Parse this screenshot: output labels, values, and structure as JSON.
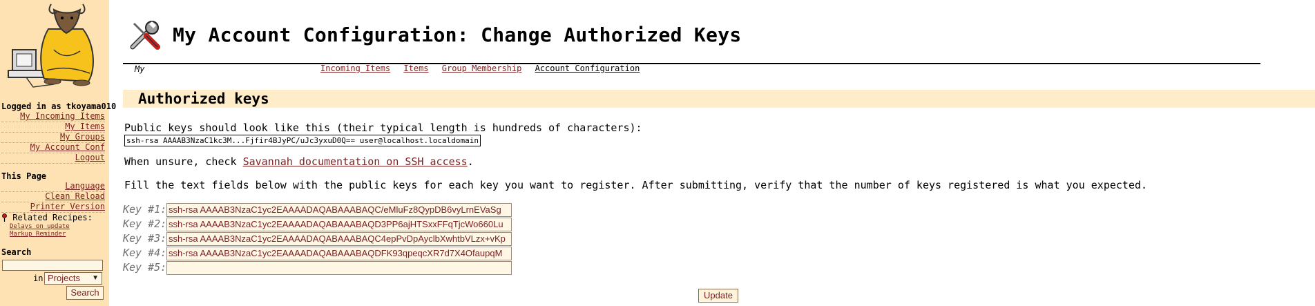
{
  "sidebar": {
    "logged_in": "Logged in as tkoyama010",
    "user_links": [
      "My Incoming Items",
      "My Items",
      "My Groups",
      "My Account Conf",
      "Logout"
    ],
    "this_page_heading": "This Page",
    "page_links": [
      "Language",
      "Clean Reload",
      "Printer Version"
    ],
    "related_heading": "Related Recipes:",
    "related_links": [
      "Delays on update",
      "Markup Reminder"
    ],
    "search": {
      "heading": "Search",
      "in_label": "in",
      "scope_value": "Projects",
      "button_label": "Search"
    }
  },
  "header": {
    "title": "My Account Configuration: Change Authorized Keys",
    "nav_my": "My",
    "nav_links": [
      {
        "label": "Incoming Items",
        "current": false
      },
      {
        "label": "Items",
        "current": false
      },
      {
        "label": "Group Membership",
        "current": false
      },
      {
        "label": "Account Configuration",
        "current": true
      }
    ]
  },
  "main": {
    "section_title": "Authorized keys",
    "intro": "Public keys should look like this (their typical length is hundreds of characters):",
    "example_key": "ssh-rsa AAAAB3NzaC1kc3M...Fjfir4BJyPC/uJc3yxuD0Q== user@localhost.localdomain",
    "unsure_prefix": "When unsure, check ",
    "unsure_link": "Savannah documentation on SSH access",
    "unsure_suffix": ".",
    "instructions": "Fill the text fields below with the public keys for each key you want to register. After submitting, verify that the number of keys registered is what you expected.",
    "keys": [
      {
        "label": "Key #1:",
        "value": "ssh-rsa AAAAB3NzaC1yc2EAAAADAQABAAABAQC/eMluFz8QypDB6vyLrnEVaSg"
      },
      {
        "label": "Key #2:",
        "value": "ssh-rsa AAAAB3NzaC1yc2EAAAADAQABAAABAQD3PP6ajHTSxxFFqTjcWo660Lu"
      },
      {
        "label": "Key #3:",
        "value": "ssh-rsa AAAAB3NzaC1yc2EAAAADAQABAAABAQC4epPvDpAyclbXwhtbVLzx+vKp"
      },
      {
        "label": "Key #4:",
        "value": "ssh-rsa AAAAB3NzaC1yc2EAAAADAQABAAABAQDFK93qpeqcXR7d7X4OfaupqM"
      },
      {
        "label": "Key #5:",
        "value": ""
      }
    ],
    "update_label": "Update"
  }
}
